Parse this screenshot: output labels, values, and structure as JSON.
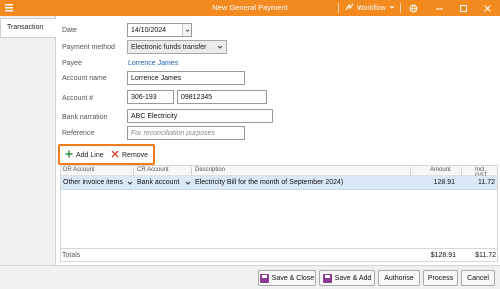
{
  "titlebar": {
    "title": "New General Payment",
    "workflow_label": "Workflow",
    "bg_color": "#f28a1f"
  },
  "tabs": [
    {
      "label": "Transaction",
      "active": true
    }
  ],
  "form": {
    "date": {
      "label": "Date",
      "value": "14/10/2024"
    },
    "payment_method": {
      "label": "Payment method",
      "value": "Electronic funds transfer"
    },
    "payee": {
      "label": "Payee",
      "value": "Lorrence James"
    },
    "account_name": {
      "label": "Account name",
      "value": "Lorrence James"
    },
    "account_number": {
      "label": "Account #",
      "bsb": "306-193",
      "number": "09812345"
    },
    "bank_narration": {
      "label": "Bank narration",
      "value": "ABC Electricity"
    },
    "reference": {
      "label": "Reference",
      "placeholder": "For reconciliation purposes"
    }
  },
  "toolbar": {
    "add_line": "Add Line",
    "remove": "Remove",
    "highlight_color": "#f07a1c"
  },
  "grid": {
    "columns": [
      "DR Account",
      "CR Account",
      "Description",
      "Amount",
      "Incl. GST"
    ],
    "rows": [
      {
        "dr_account": "Other invoice items",
        "cr_account": "Bank account",
        "description": "Electricity Bill for the month of September 2024)",
        "amount": "128.91",
        "incl_gst": "11.72"
      }
    ]
  },
  "totals": {
    "label": "Totals",
    "amount": "$128.91",
    "incl_gst": "$11.72"
  },
  "buttons": {
    "save_close": "Save & Close",
    "save_add": "Save & Add",
    "authorise": "Authorise",
    "process": "Process",
    "cancel": "Cancel"
  }
}
